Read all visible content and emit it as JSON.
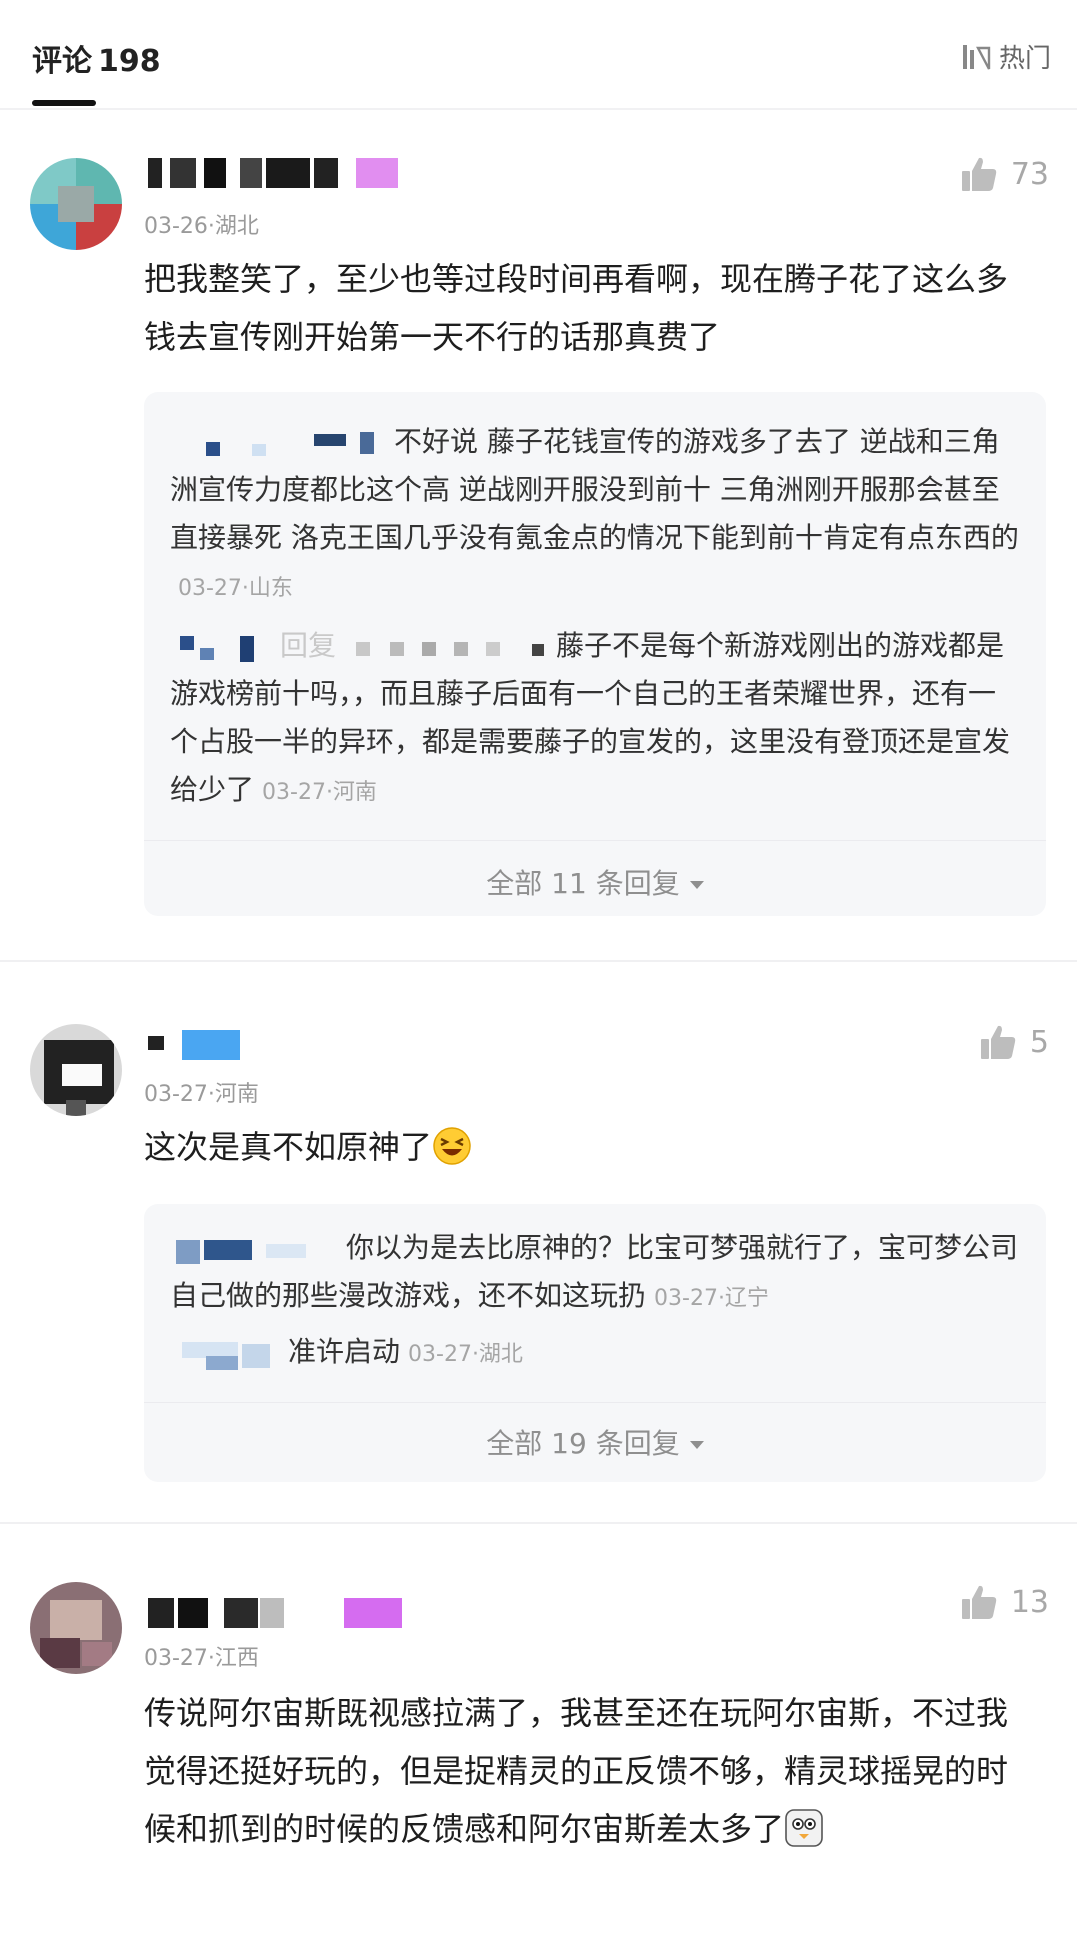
{
  "header": {
    "title": "评论",
    "count": "198",
    "sort_label": "热门"
  },
  "comments": [
    {
      "meta": "03-26·湖北",
      "likes": "73",
      "text": "把我整笑了，至少也等过段时间再看啊，现在腾子花了这么多钱去宣传刚开始第一天不行的话那真费了",
      "replies": [
        {
          "text": "不好说 藤子花钱宣传的游戏多了去了 逆战和三角洲宣传力度都比这个高 逆战刚开服没到前十 三角洲刚开服那会甚至直接暴死 洛克王国几乎没有氪金点的情况下能到前十肯定有点东西的",
          "time": "03-27·山东"
        },
        {
          "prefix": "回复",
          "text": "藤子不是每个新游戏刚出的游戏都是游戏榜前十吗，，而且藤子后面有一个自己的王者荣耀世界，还有一个占股一半的异环，都是需要藤子的宣发的，这里没有登顶还是宣发给少了",
          "time": "03-27·河南"
        }
      ],
      "more": "全部 11 条回复"
    },
    {
      "meta": "03-27·河南",
      "likes": "5",
      "text": "这次是真不如原神了",
      "emoji": "laughing-emoji",
      "replies": [
        {
          "text": "你以为是去比原神的？比宝可梦强就行了，宝可梦公司自己做的那些漫改游戏，还不如这玩扔",
          "time": "03-27·辽宁"
        },
        {
          "text": "准许启动",
          "time": "03-27·湖北"
        }
      ],
      "more": "全部 19 条回复"
    },
    {
      "meta": "03-27·江西",
      "likes": "13",
      "text": "传说阿尔宙斯既视感拉满了，我甚至还在玩阿尔宙斯，不过我觉得还挺好玩的，但是捉精灵的正反馈不够，精灵球摇晃的时候和抓到的时候的反馈感和阿尔宙斯差太多了",
      "emoji": "penguin-emoji"
    }
  ],
  "icons": {
    "sort": "sort-icon",
    "like": "thumbs-up-icon",
    "caret": "caret-down-icon"
  },
  "colors": {
    "reply_bg": "#f6f7f9",
    "meta": "#9a9a9a",
    "like": "#a8a8a8"
  }
}
